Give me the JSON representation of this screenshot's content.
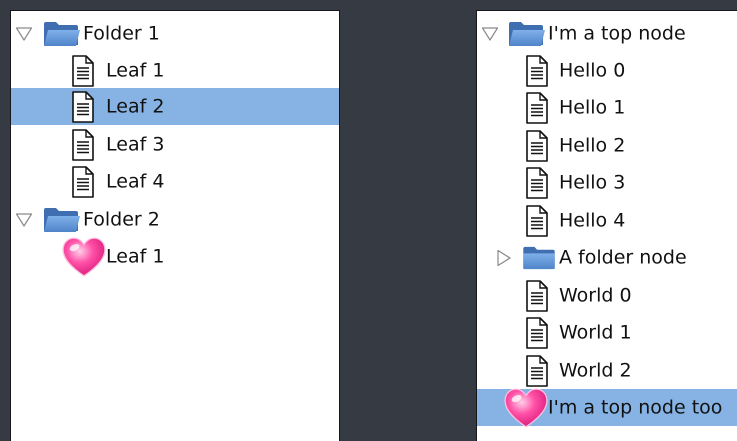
{
  "left_tree": {
    "folder1": {
      "label": "Folder 1",
      "icon": "folder-open-icon",
      "expanded": true
    },
    "folder1_leaves": [
      "Leaf 1",
      "Leaf 2",
      "Leaf 3",
      "Leaf 4"
    ],
    "selected_leaf": "Leaf 2",
    "folder2": {
      "label": "Folder 2",
      "icon": "folder-open-icon",
      "expanded": true
    },
    "folder2_leaves": [
      "Leaf 1"
    ],
    "folder2_leaf_icon": "heart-icon"
  },
  "right_tree": {
    "top_node": {
      "label": "I'm a top node",
      "icon": "folder-open-icon",
      "expanded": true
    },
    "hello_items": [
      "Hello 0",
      "Hello 1",
      "Hello 2",
      "Hello 3",
      "Hello 4"
    ],
    "folder_node": {
      "label": "A folder node",
      "icon": "folder-closed-icon",
      "expanded": false
    },
    "world_items": [
      "World 0",
      "World 1",
      "World 2"
    ],
    "top_node_too": {
      "label": "I'm a top node too",
      "icon": "heart-icon",
      "selected": true
    }
  },
  "colors": {
    "background": "#363a42",
    "panel": "#ffffff",
    "selection": "#86b3e4",
    "folder": "#5b8fd0"
  }
}
